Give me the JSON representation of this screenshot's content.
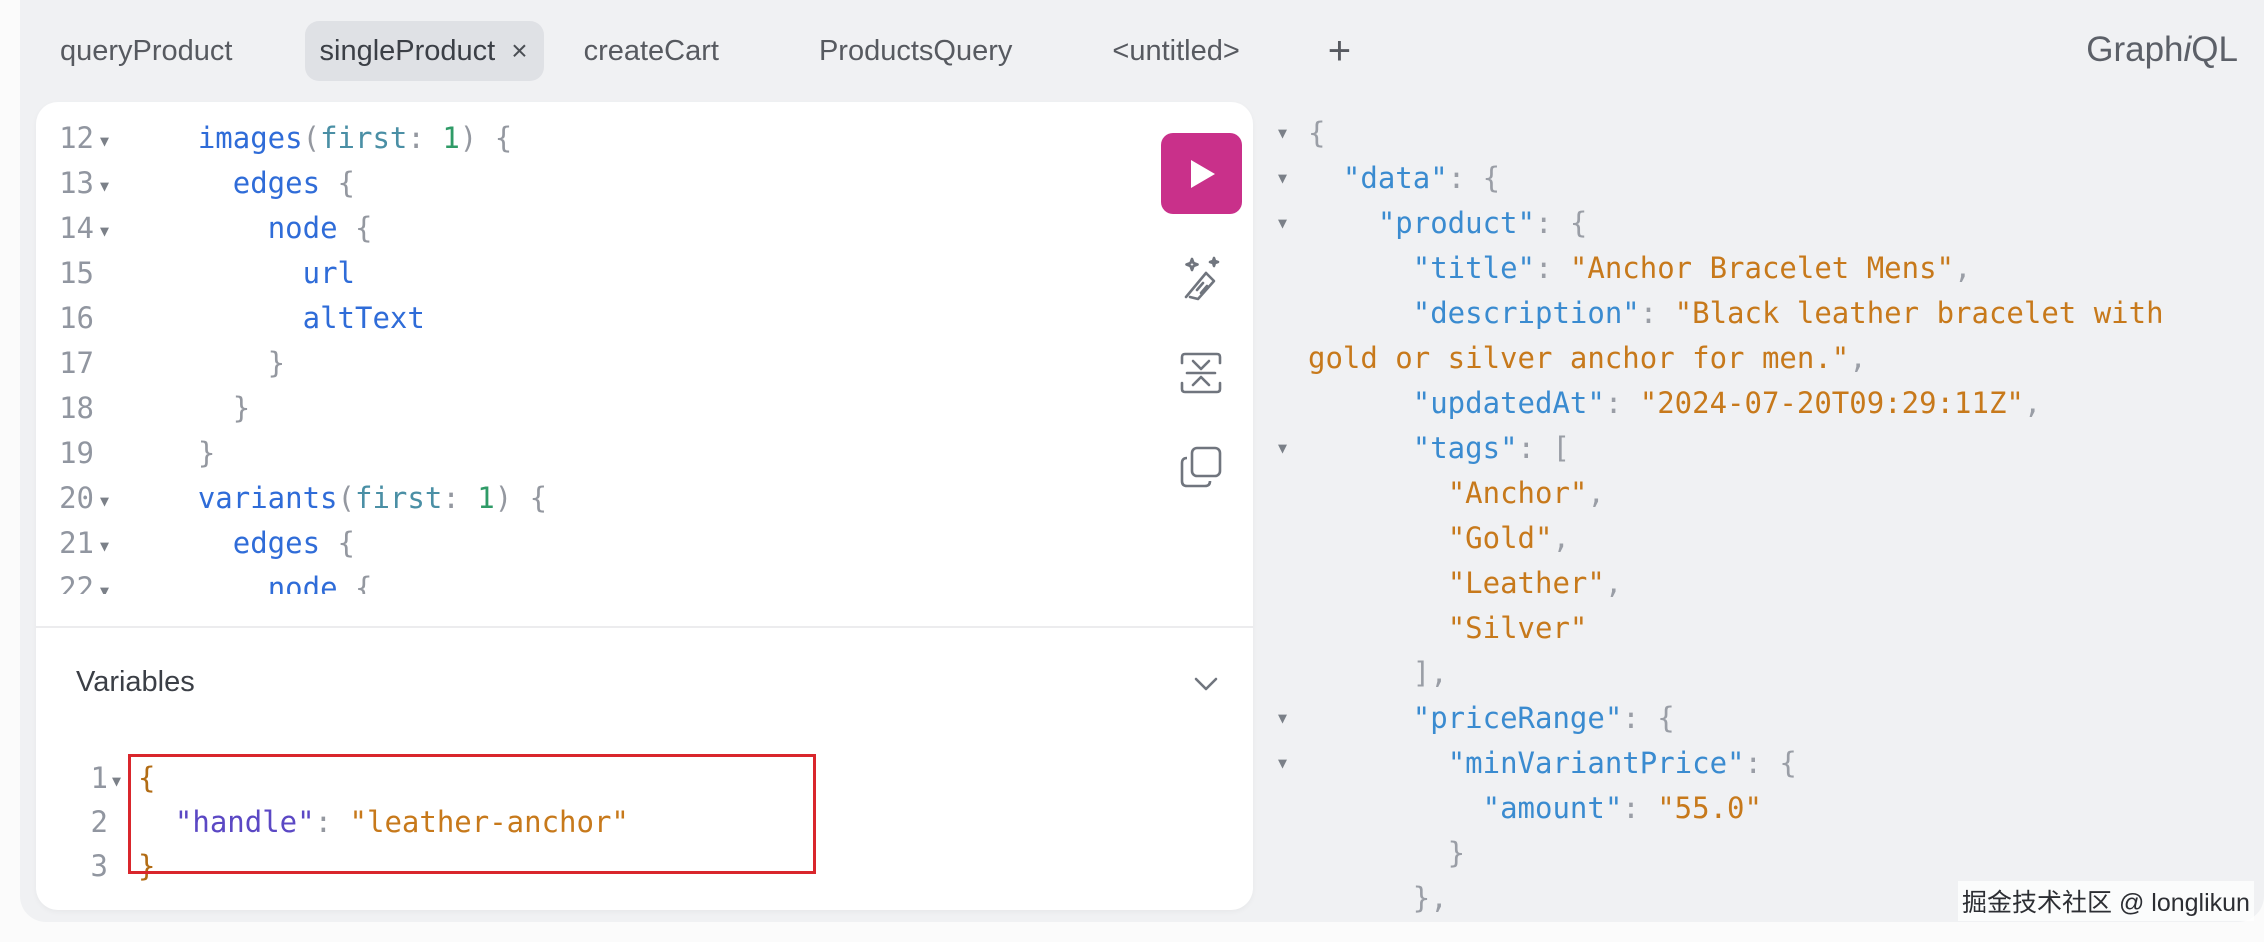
{
  "tabs": [
    {
      "label": "queryProduct",
      "active": false
    },
    {
      "label": "singleProduct",
      "active": true
    },
    {
      "label": "createCart",
      "active": false
    },
    {
      "label": "ProductsQuery",
      "active": false
    },
    {
      "label": "<untitled>",
      "active": false
    }
  ],
  "tab_close": "×",
  "tab_add": "+",
  "brand": {
    "prefix": "Graph",
    "italic": "i",
    "suffix": "QL"
  },
  "editor": {
    "lines": [
      {
        "n": "12",
        "fold": true
      },
      {
        "n": "13",
        "fold": true
      },
      {
        "n": "14",
        "fold": true
      },
      {
        "n": "15",
        "fold": false
      },
      {
        "n": "16",
        "fold": false
      },
      {
        "n": "17",
        "fold": false
      },
      {
        "n": "18",
        "fold": false
      },
      {
        "n": "19",
        "fold": false
      },
      {
        "n": "20",
        "fold": true
      },
      {
        "n": "21",
        "fold": true
      },
      {
        "n": "22",
        "fold": true
      }
    ],
    "tokens": {
      "images": "images",
      "first": "first",
      "one": "1",
      "edges": "edges",
      "node": "node",
      "url": "url",
      "altText": "altText",
      "variants": "variants"
    }
  },
  "toolbar": {
    "run_icon": "play-icon",
    "prettify_icon": "magic-wand-icon",
    "merge_icon": "merge-fragments-icon",
    "copy_icon": "copy-icon"
  },
  "variables": {
    "header": "Variables",
    "lines": [
      "1",
      "2",
      "3"
    ],
    "key": "\"handle\"",
    "value": "\"leather-anchor\""
  },
  "result": {
    "data_key": "\"data\"",
    "product_key": "\"product\"",
    "title_key": "\"title\"",
    "title_val": "\"Anchor Bracelet Mens\"",
    "description_key": "\"description\"",
    "description_val_1": "\"Black leather bracelet with",
    "description_val_2": "gold or silver anchor for men.\"",
    "updatedAt_key": "\"updatedAt\"",
    "updatedAt_val": "\"2024-07-20T09:29:11Z\"",
    "tags_key": "\"tags\"",
    "tags": [
      "\"Anchor\"",
      "\"Gold\"",
      "\"Leather\"",
      "\"Silver\""
    ],
    "priceRange_key": "\"priceRange\"",
    "minVariantPrice_key": "\"minVariantPrice\"",
    "amount_key": "\"amount\"",
    "amount_val": "\"55.0\""
  },
  "watermark": "掘金技术社区 @ longlikun",
  "colors": {
    "run_button": "#c9308a",
    "highlight_box": "#d9262c"
  }
}
